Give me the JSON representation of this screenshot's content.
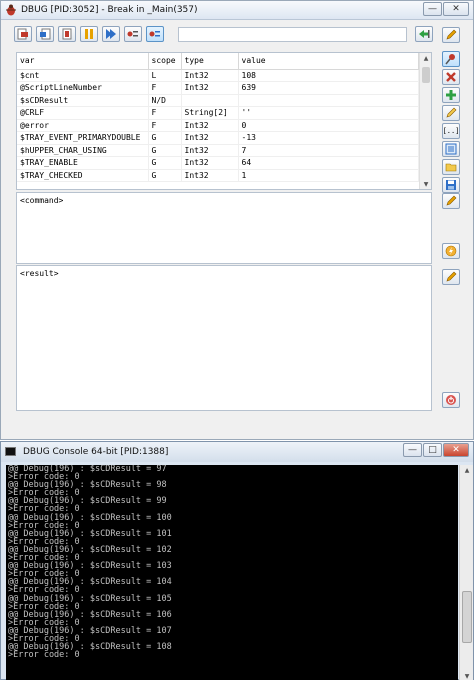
{
  "dbug_window": {
    "title": "DBUG [PID:3052] - Break in _Main(357)",
    "command_label": "<command>",
    "result_label": "<result>",
    "variables": {
      "columns": [
        "var",
        "scope",
        "type",
        "value"
      ],
      "rows": [
        [
          "$cnt",
          "L",
          "Int32",
          "108"
        ],
        [
          "@ScriptLineNumber",
          "F",
          "Int32",
          "639"
        ],
        [
          "$sCDResult",
          "N/D",
          "",
          ""
        ],
        [
          "@CRLF",
          "F",
          "String[2]",
          "''"
        ],
        [
          "@error",
          "F",
          "Int32",
          "0"
        ],
        [
          "$TRAY_EVENT_PRIMARYDOUBLE",
          "G",
          "Int32",
          "-13"
        ],
        [
          "$hUPPER_CHAR_USING",
          "G",
          "Int32",
          "7"
        ],
        [
          "$TRAY_ENABLE",
          "G",
          "Int32",
          "64"
        ],
        [
          "$TRAY_CHECKED",
          "G",
          "Int32",
          "1"
        ]
      ]
    },
    "side_buttons": {
      "clear_label": "[..]"
    }
  },
  "console_window": {
    "title": "DBUG Console 64-bit [PID:1388]",
    "lines": [
      "@@ Debug(196) : $sCDResult = 97",
      ">Error code: 0",
      "@@ Debug(196) : $sCDResult = 98",
      ">Error code: 0",
      "@@ Debug(196) : $sCDResult = 99",
      ">Error code: 0",
      "@@ Debug(196) : $sCDResult = 100",
      ">Error code: 0",
      "@@ Debug(196) : $sCDResult = 101",
      ">Error code: 0",
      "@@ Debug(196) : $sCDResult = 102",
      ">Error code: 0",
      "@@ Debug(196) : $sCDResult = 103",
      ">Error code: 0",
      "@@ Debug(196) : $sCDResult = 104",
      ">Error code: 0",
      "@@ Debug(196) : $sCDResult = 105",
      ">Error code: 0",
      "@@ Debug(196) : $sCDResult = 106",
      ">Error code: 0",
      "@@ Debug(196) : $sCDResult = 107",
      ">Error code: 0",
      "@@ Debug(196) : $sCDResult = 108",
      ">Error code: 0"
    ]
  },
  "colors": {
    "console_bg": "#000000",
    "console_text": "#c0c0c0",
    "window_bg": "#f0f0f0"
  }
}
